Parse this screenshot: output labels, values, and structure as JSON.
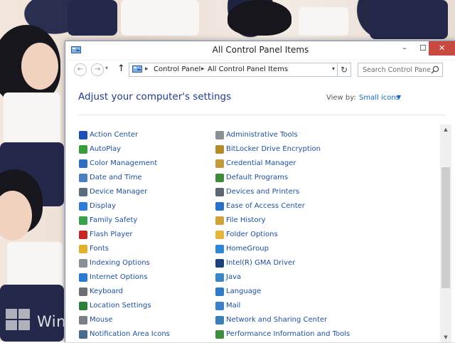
{
  "window": {
    "title": "All Control Panel Items",
    "controls": {
      "minimize": "–",
      "maximize": "☐",
      "close": "✕"
    }
  },
  "address": {
    "back_icon": "←",
    "forward_icon": "→",
    "up_icon": "↑",
    "crumb_separator": "▸",
    "breadcrumbs": [
      "Control Panel",
      "All Control Panel Items"
    ],
    "dropdown_icon": "▾",
    "refresh_icon": "↻",
    "search_placeholder": "Search Control Panel"
  },
  "main": {
    "heading": "Adjust your computer's settings",
    "view_by_label": "View by:",
    "view_by_value": "Small icons",
    "view_by_caret": "▼"
  },
  "desktop": {
    "watermark": "Wind"
  },
  "items_left": [
    {
      "label": "Action Center",
      "icon": "flag-icon",
      "color": "#1f4fb3"
    },
    {
      "label": "AutoPlay",
      "icon": "autoplay-icon",
      "color": "#3a9b3a"
    },
    {
      "label": "Color Management",
      "icon": "color-management-icon",
      "color": "#2d6fc4"
    },
    {
      "label": "Date and Time",
      "icon": "clock-icon",
      "color": "#4a7fc0"
    },
    {
      "label": "Device Manager",
      "icon": "device-manager-icon",
      "color": "#5a6b7d"
    },
    {
      "label": "Display",
      "icon": "display-icon",
      "color": "#2f7bd8"
    },
    {
      "label": "Family Safety",
      "icon": "family-safety-icon",
      "color": "#3aa04b"
    },
    {
      "label": "Flash Player",
      "icon": "flash-icon",
      "color": "#c62828"
    },
    {
      "label": "Fonts",
      "icon": "fonts-icon",
      "color": "#e0b12a"
    },
    {
      "label": "Indexing Options",
      "icon": "indexing-icon",
      "color": "#8a8f96"
    },
    {
      "label": "Internet Options",
      "icon": "internet-icon",
      "color": "#2b7bd1"
    },
    {
      "label": "Keyboard",
      "icon": "keyboard-icon",
      "color": "#6b6f75"
    },
    {
      "label": "Location Settings",
      "icon": "location-icon",
      "color": "#2d7f3c"
    },
    {
      "label": "Mouse",
      "icon": "mouse-icon",
      "color": "#7a7f86"
    },
    {
      "label": "Notification Area Icons",
      "icon": "notification-icon",
      "color": "#4a6c8a"
    }
  ],
  "items_right": [
    {
      "label": "Administrative Tools",
      "icon": "admin-tools-icon",
      "color": "#8c8f94"
    },
    {
      "label": "BitLocker Drive Encryption",
      "icon": "bitlocker-icon",
      "color": "#b38b2a"
    },
    {
      "label": "Credential Manager",
      "icon": "credential-icon",
      "color": "#c29a3c"
    },
    {
      "label": "Default Programs",
      "icon": "default-programs-icon",
      "color": "#3f8b3a"
    },
    {
      "label": "Devices and Printers",
      "icon": "printer-icon",
      "color": "#5c6670"
    },
    {
      "label": "Ease of Access Center",
      "icon": "ease-of-access-icon",
      "color": "#2a6fc9"
    },
    {
      "label": "File History",
      "icon": "file-history-icon",
      "color": "#d0a33a"
    },
    {
      "label": "Folder Options",
      "icon": "folder-icon",
      "color": "#e4b73c"
    },
    {
      "label": "HomeGroup",
      "icon": "homegroup-icon",
      "color": "#2d86d6"
    },
    {
      "label": "Intel(R) GMA Driver",
      "icon": "intel-icon",
      "color": "#1d3f7a"
    },
    {
      "label": "Java",
      "icon": "java-icon",
      "color": "#3a86c8"
    },
    {
      "label": "Language",
      "icon": "language-icon",
      "color": "#2f7bc8"
    },
    {
      "label": "Mail",
      "icon": "mail-icon",
      "color": "#3a7fc9"
    },
    {
      "label": "Network and Sharing Center",
      "icon": "network-icon",
      "color": "#3a7fb8"
    },
    {
      "label": "Performance Information and Tools",
      "icon": "performance-icon",
      "color": "#3e8e3e"
    }
  ]
}
